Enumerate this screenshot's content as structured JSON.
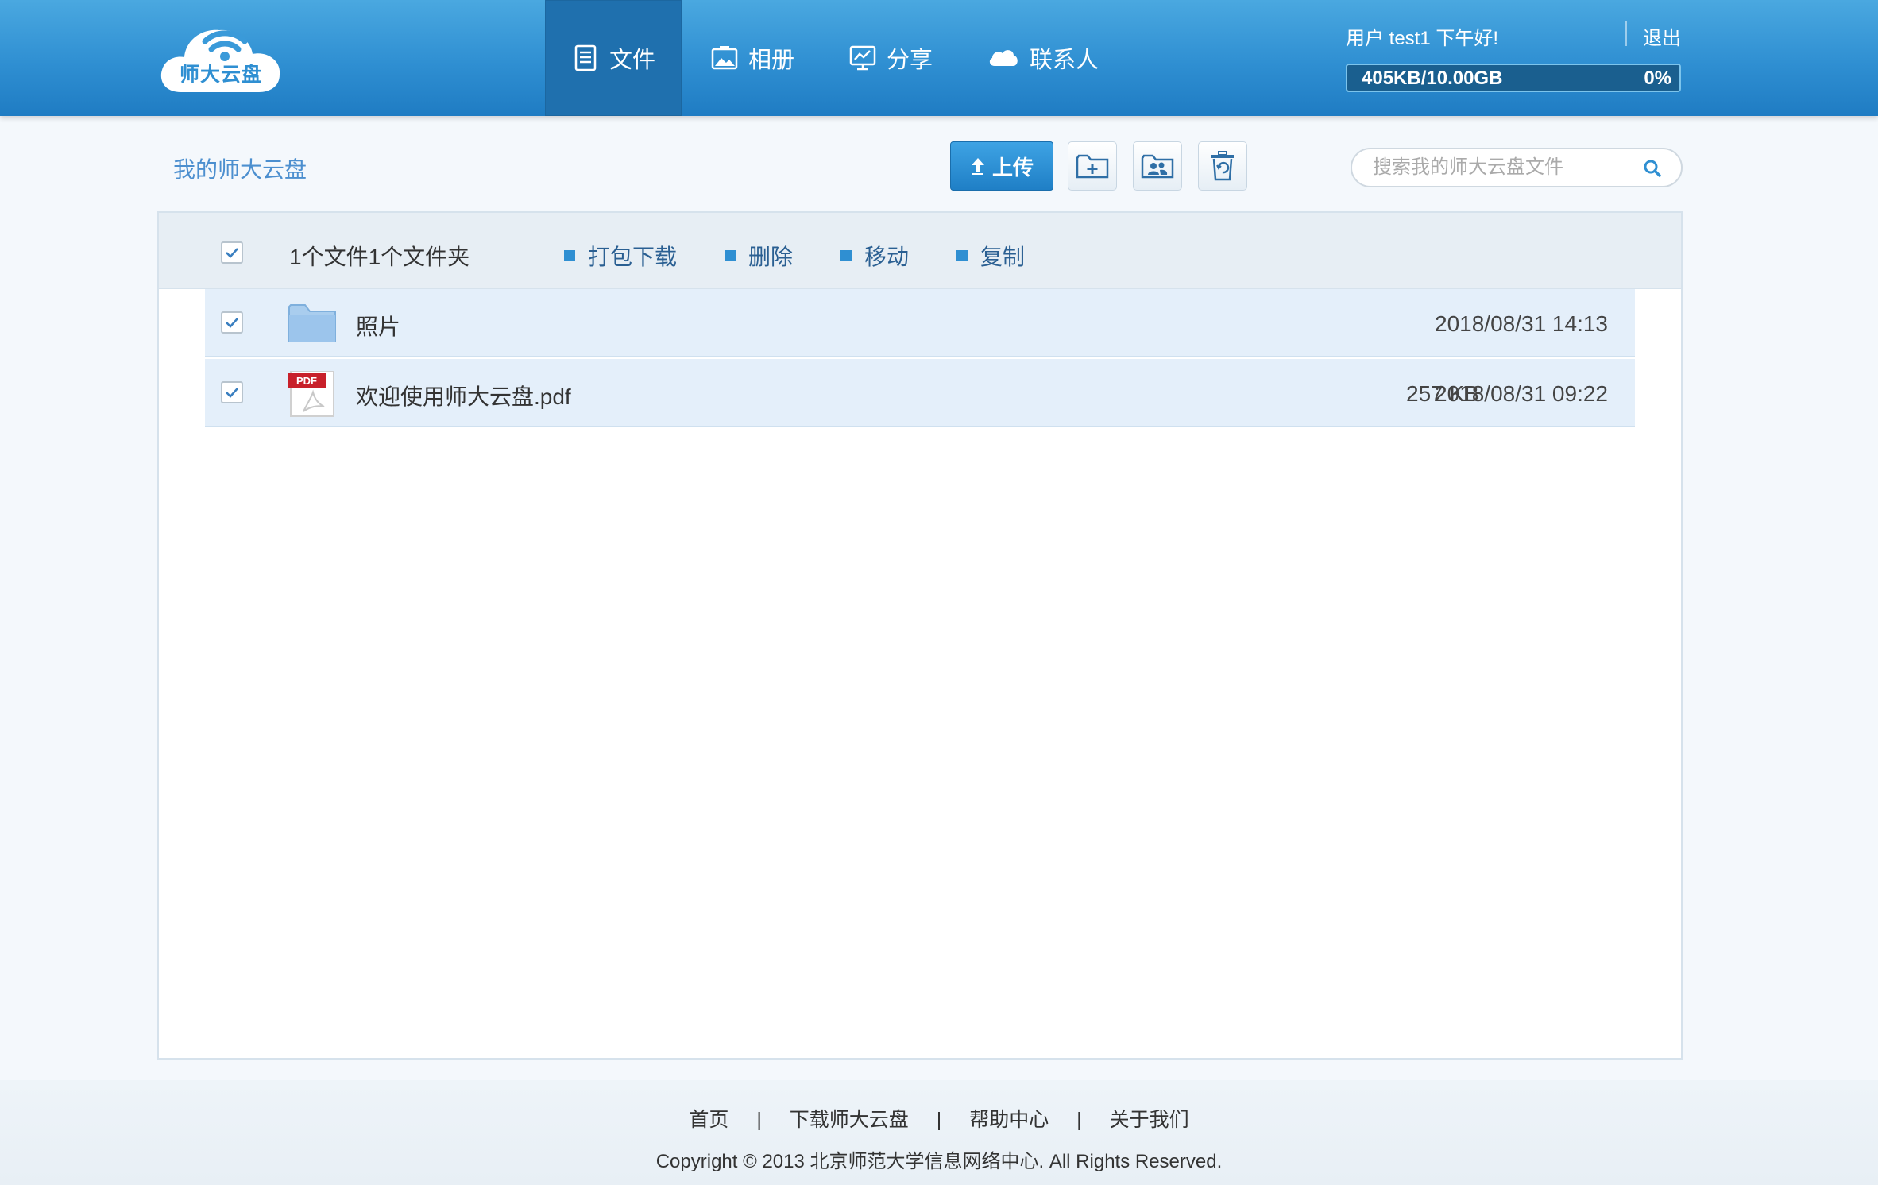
{
  "header": {
    "logo_text": "师大云盘",
    "nav": [
      {
        "label": "文件",
        "icon": "document-icon",
        "active": true
      },
      {
        "label": "相册",
        "icon": "photo-icon",
        "active": false
      },
      {
        "label": "分享",
        "icon": "share-monitor-icon",
        "active": false
      },
      {
        "label": "联系人",
        "icon": "contacts-cloud-icon",
        "active": false
      }
    ],
    "greeting": "用户 test1 下午好!",
    "logout": "退出",
    "quota": {
      "used_label": "405KB/10.00GB",
      "percent_label": "0%",
      "fraction": 0.0
    },
    "colors": {
      "header_blue": "#2f8fd2",
      "active_tab": "#1f70ae"
    }
  },
  "toolbar": {
    "breadcrumb": "我的师大云盘",
    "upload_label": "上传",
    "new_folder_icon": "folder-plus-icon",
    "share_folder_icon": "folder-users-icon",
    "trash_icon": "trash-icon",
    "search_placeholder": "搜索我的师大云盘文件"
  },
  "list": {
    "summary": "1个文件1个文件夹",
    "actions": [
      "打包下载",
      "删除",
      "移动",
      "复制"
    ],
    "rows": [
      {
        "name": "照片",
        "type": "folder",
        "size": "",
        "date": "2018/08/31 14:13",
        "checked": true
      },
      {
        "name": "欢迎使用师大云盘.pdf",
        "type": "pdf",
        "size": "257 KB",
        "date": "2018/08/31 09:22",
        "checked": true
      }
    ]
  },
  "footer": {
    "links": [
      "首页",
      "下载师大云盘",
      "帮助中心",
      "关于我们"
    ],
    "separator": "|",
    "copyright": "Copyright © 2013 北京师范大学信息网络中心. All Rights Reserved."
  }
}
